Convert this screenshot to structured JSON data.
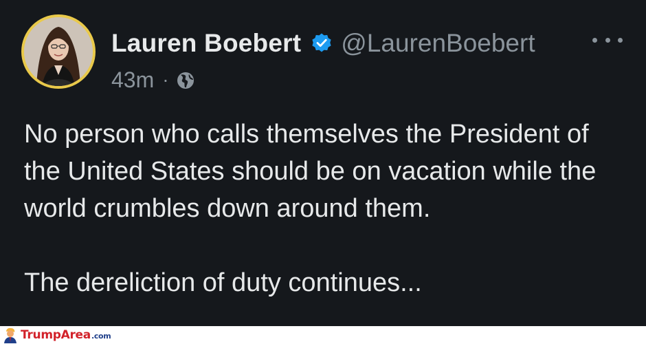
{
  "tweet": {
    "author": {
      "display_name": "Lauren Boebert",
      "handle": "@LaurenBoebert",
      "verified": true,
      "verified_icon": "verified-badge-icon",
      "avatar_ring_color": "#e9c94a"
    },
    "timestamp": "43m",
    "separator": "·",
    "visibility_icon": "globe-icon",
    "more_icon": "more-options-icon",
    "text": {
      "paragraph_1": "No person who calls themselves the President of the United States should be on vacation while the world crumbles down around them.",
      "paragraph_2": "The dereliction of duty continues..."
    }
  },
  "watermark": {
    "name": "TrumpArea",
    "tld": ".com"
  },
  "colors": {
    "background": "#15181c",
    "primary_text": "#e7e9ea",
    "secondary_text": "#8b949c",
    "verified_blue": "#1d9bf0",
    "watermark_red": "#d2222a",
    "watermark_blue": "#1f3f8a"
  }
}
